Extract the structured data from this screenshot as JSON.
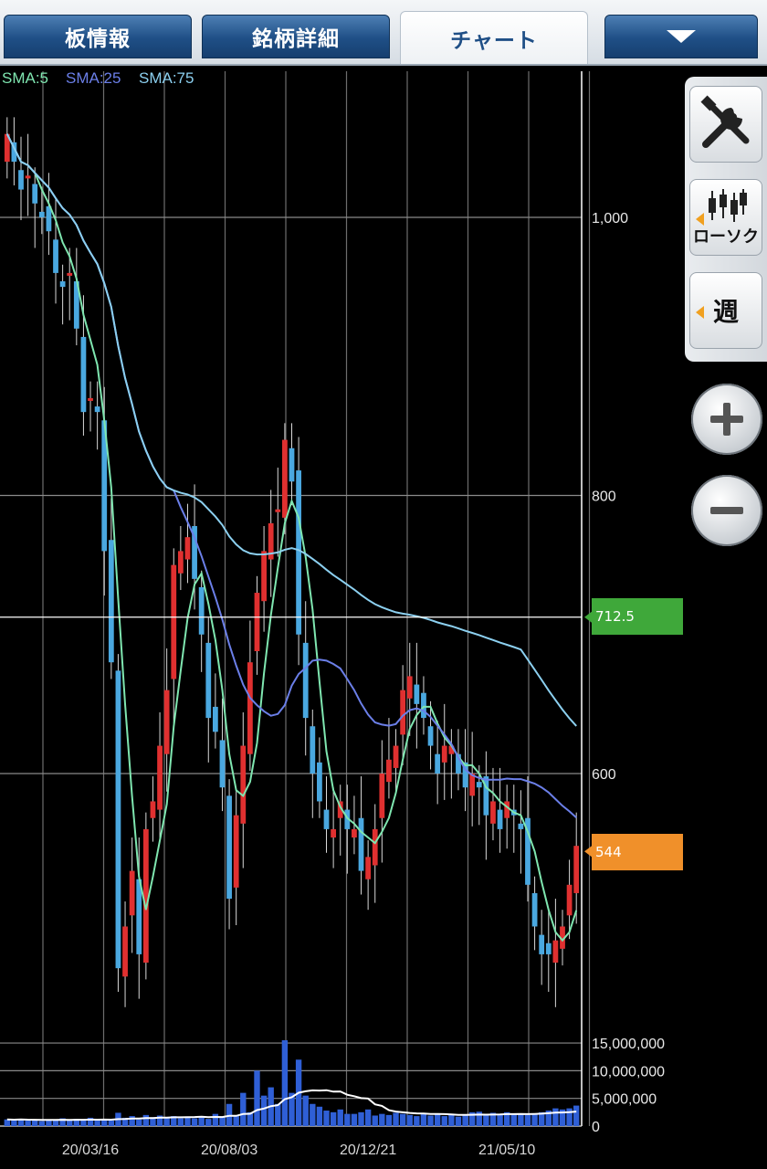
{
  "tabs": [
    {
      "label": "板情報",
      "active": false
    },
    {
      "label": "銘柄詳細",
      "active": false
    },
    {
      "label": "チャート",
      "active": true
    }
  ],
  "menu_button_icon": "dropdown-triangle-icon",
  "toolbar": {
    "settings_icon": "wrench-screwdriver-icon",
    "chart_type_label": "ローソク",
    "period_label": "週",
    "zoom_in_icon": "plus-icon",
    "zoom_out_icon": "minus-icon"
  },
  "price_tags": {
    "crosshair": "712.5",
    "last": "544"
  },
  "colors": {
    "up_candle": "#e03030",
    "down_candle": "#4aa8e0",
    "sma5": "#7fe6b0",
    "sma25": "#6b7fe8",
    "sma75": "#8cd0f0",
    "volume_bar": "#2f5fd6",
    "crosshair_tag": "#3fa83a",
    "last_tag": "#f0902a"
  },
  "chart_data": {
    "type": "candlestick",
    "legend": [
      "SMA:5",
      "SMA:25",
      "SMA:75"
    ],
    "price_ticks": [
      "1,000",
      "800",
      "600"
    ],
    "price_tick_values": [
      1000,
      800,
      600
    ],
    "price_range": [
      410,
      1110
    ],
    "volume_ticks": [
      "15,000,000",
      "10,000,000",
      "5,000,000",
      "0"
    ],
    "volume_tick_values": [
      15000000,
      10000000,
      5000000,
      0
    ],
    "volume_range": [
      0,
      16000000
    ],
    "date_labels": [
      "20/03/16",
      "20/08/03",
      "20/12/21",
      "21/05/10"
    ],
    "date_label_index": [
      12,
      32,
      52,
      72
    ],
    "crosshair_price": 712.5,
    "last_price": 544,
    "close": [
      1060,
      1040,
      1020,
      1030,
      1010,
      1000,
      990,
      960,
      950,
      960,
      920,
      860,
      870,
      860,
      760,
      680,
      460,
      490,
      530,
      470,
      560,
      580,
      620,
      660,
      750,
      760,
      770,
      740,
      700,
      640,
      630,
      590,
      510,
      570,
      620,
      680,
      730,
      760,
      780,
      790,
      840,
      810,
      700,
      640,
      600,
      580,
      560,
      560,
      580,
      560,
      560,
      530,
      540,
      560,
      600,
      610,
      620,
      660,
      670,
      650,
      640,
      620,
      600,
      620,
      620,
      600,
      590,
      600,
      590,
      570,
      580,
      560,
      580,
      570,
      560,
      520,
      490,
      470,
      470,
      480,
      490,
      520,
      548
    ],
    "volume": [
      1200000,
      1100000,
      1300000,
      1000000,
      1100000,
      900000,
      1200000,
      1000000,
      1400000,
      1000000,
      1300000,
      1200000,
      1500000,
      1100000,
      1300000,
      1000000,
      2400000,
      1500000,
      1800000,
      1200000,
      2000000,
      1600000,
      1900000,
      1500000,
      1800000,
      1400000,
      1700000,
      1400000,
      1600000,
      1300000,
      2200000,
      1700000,
      4000000,
      1900000,
      6000000,
      2500000,
      10000000,
      5500000,
      7000000,
      4000000,
      15500000,
      6000000,
      12000000,
      5500000,
      4000000,
      3500000,
      2800000,
      2500000,
      3000000,
      2200000,
      2200000,
      2500000,
      3000000,
      1900000,
      2200000,
      2000000,
      2400000,
      2200000,
      2000000,
      1800000,
      2200000,
      1900000,
      2100000,
      1800000,
      2000000,
      1700000,
      1900000,
      2500000,
      2600000,
      2200000,
      2400000,
      2200000,
      2500000,
      2200000,
      2100000,
      2000000,
      2300000,
      2500000,
      2800000,
      3200000,
      3000000,
      3200000,
      3700000
    ]
  }
}
